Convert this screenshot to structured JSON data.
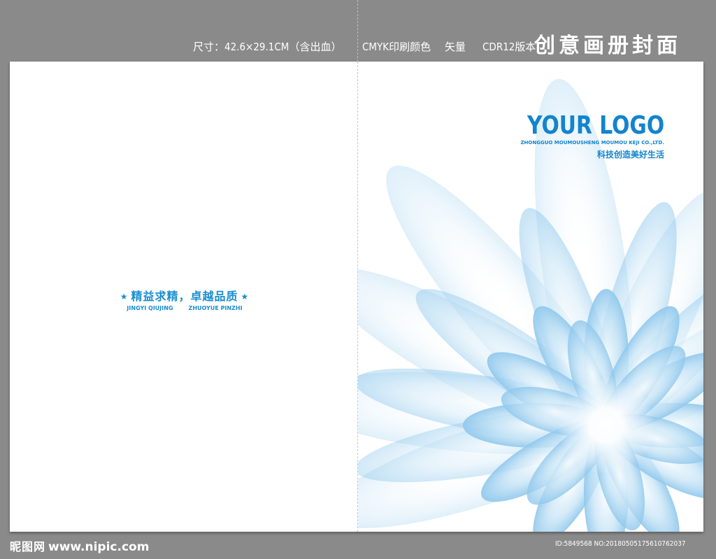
{
  "header": {
    "spec_size": "尺寸：42.6×29.1CM（含出血）",
    "spec_color": "CMYK印刷颜色",
    "spec_vector": "矢量",
    "spec_version": "CDR12版本",
    "headline": "创意画册封面"
  },
  "back_cover": {
    "slogan_cn": "精益求精，卓越品质",
    "slogan_en_left": "JINGYI QIUJING",
    "slogan_en_right": "ZHUOYUE PINZHI",
    "star_glyph": "★"
  },
  "front_cover": {
    "logo_text": "YOUR LOGO",
    "company_en": "ZHONGGUO MOUMOUSHENG MOUMOU KEJI CO.,LTD.",
    "slogan_cn": "科技创造美好生活"
  },
  "watermark": {
    "site_cn": "昵图网",
    "site_url": "www.nipic.com",
    "id_text": "ID:5849568 NO:20180505175610762037"
  },
  "colors": {
    "brand_blue": "#1384cc",
    "slogan_blue": "#1a8ed0",
    "frame_gray": "#8a8a8a",
    "petal_blue": "#9fd0ef"
  }
}
